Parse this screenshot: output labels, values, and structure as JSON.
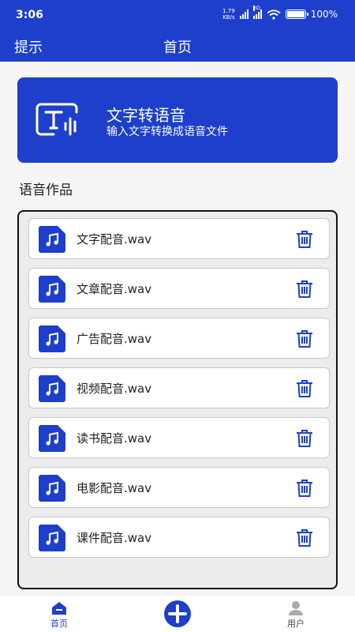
{
  "statusbar": {
    "time": "3:06",
    "net_speed_top": "1.79",
    "net_speed_bottom": "KB/s",
    "signal_label": "HD",
    "battery": "100%"
  },
  "topbar": {
    "hint_label": "提示",
    "title": "首页"
  },
  "banner": {
    "title": "文字转语音",
    "subtitle": "输入文字转换成语音文件",
    "icon": "text-to-speech-icon"
  },
  "works": {
    "section_title": "语音作品",
    "items": [
      {
        "name": "文字配音.wav"
      },
      {
        "name": "文章配音.wav"
      },
      {
        "name": "广告配音.wav"
      },
      {
        "name": "视频配音.wav"
      },
      {
        "name": "读书配音.wav"
      },
      {
        "name": "电影配音.wav"
      },
      {
        "name": "课件配音.wav"
      }
    ]
  },
  "tabbar": {
    "home_label": "首页",
    "add": "plus-icon",
    "user_label": "用户"
  },
  "colors": {
    "primary": "#1d3fcc",
    "background": "#f5f5f5"
  }
}
